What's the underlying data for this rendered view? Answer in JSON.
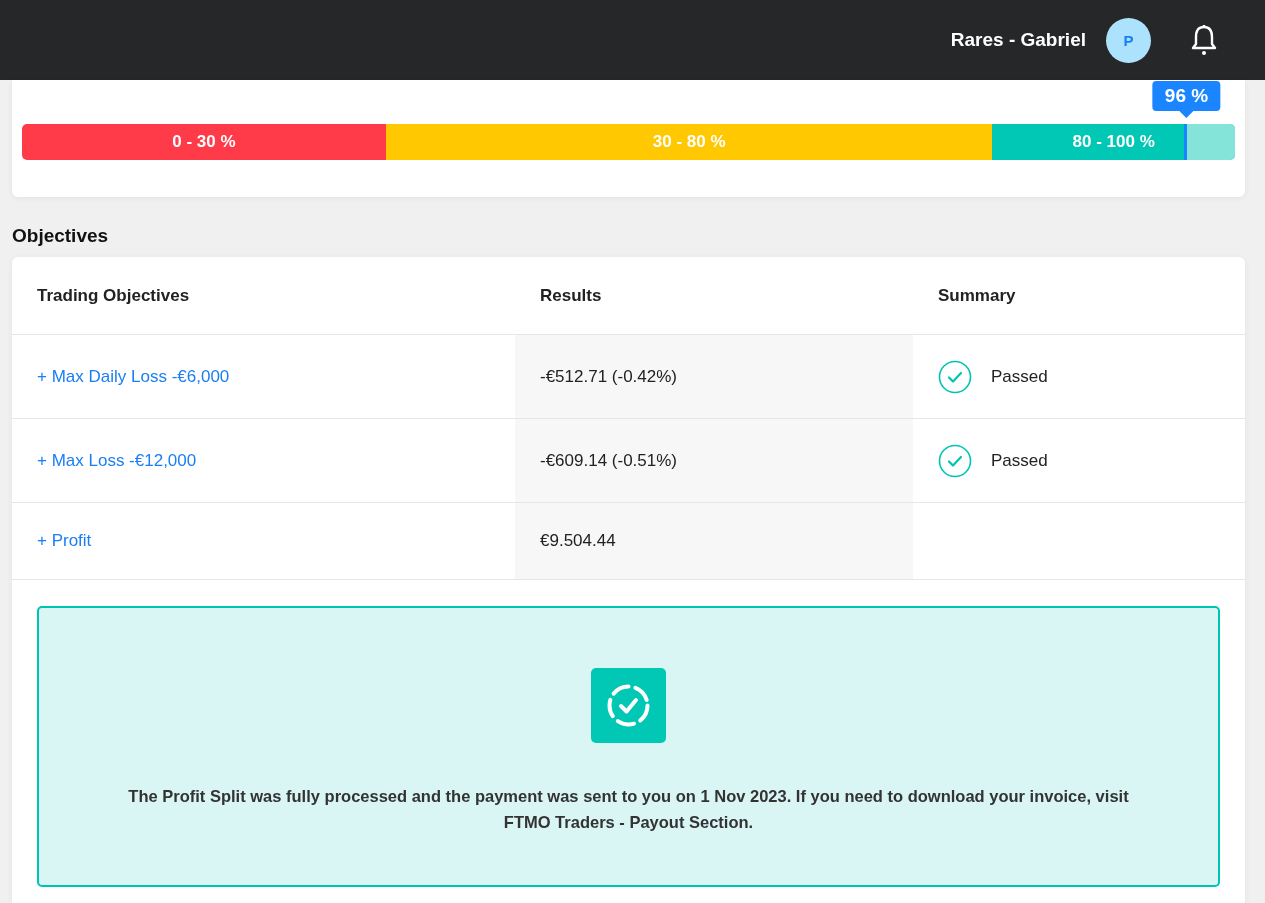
{
  "header": {
    "user_name": "Rares - Gabriel",
    "avatar_initial": "P"
  },
  "progress": {
    "level": 0.96,
    "reading": "96 %",
    "segments": [
      {
        "label": "0 - 30 %",
        "color": "#ff3b4a"
      },
      {
        "label": "30 - 80 %",
        "color": "#ffc800"
      },
      {
        "label": "80 - 100 %",
        "color": "#00c8b4"
      }
    ]
  },
  "objectives": {
    "title": "Objectives",
    "columns": [
      "Trading Objectives",
      "Results",
      "Summary"
    ],
    "rows": [
      {
        "objective": "+ Max Daily Loss -€6,000",
        "result": "-€512.71 (-0.42%)",
        "passed": true,
        "summary": "Passed"
      },
      {
        "objective": "+ Max Loss -€12,000",
        "result": "-€609.14 (-0.51%)",
        "passed": true,
        "summary": "Passed"
      },
      {
        "objective": "+ Profit",
        "result": "€9.504.44",
        "passed": false
      }
    ],
    "notice": "The Profit Split was fully processed and the payment was sent to you on 1 Nov 2023. If you need to download your invoice, visit FTMO Traders - Payout Section."
  }
}
